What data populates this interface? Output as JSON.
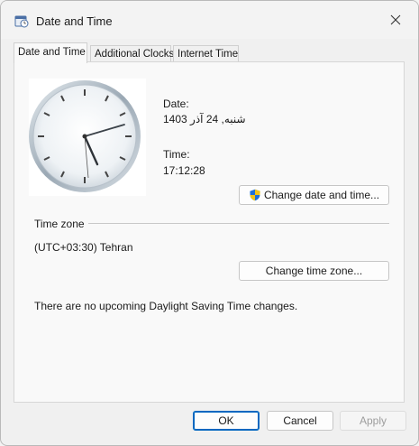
{
  "window": {
    "title": "Date and Time",
    "app_icon": "date-time-icon",
    "close_icon": "close-icon"
  },
  "tabs": [
    {
      "label": "Date and Time",
      "active": true
    },
    {
      "label": "Additional Clocks",
      "active": false
    },
    {
      "label": "Internet Time",
      "active": false
    }
  ],
  "date_time": {
    "date_label": "Date:",
    "date_value": "شنبه, 24 آذر 1403",
    "time_label": "Time:",
    "time_value": "17:12:28",
    "change_button": "Change date and time...",
    "change_button_icon": "uac-shield-icon"
  },
  "time_zone": {
    "heading": "Time zone",
    "value": "(UTC+03:30) Tehran",
    "change_button": "Change time zone...",
    "dst_note": "There are no upcoming Daylight Saving Time changes."
  },
  "footer": {
    "ok": "OK",
    "cancel": "Cancel",
    "apply": "Apply"
  },
  "colors": {
    "accent": "#0067c0",
    "shield_blue": "#1e6fd9",
    "shield_yellow": "#f2c318"
  }
}
